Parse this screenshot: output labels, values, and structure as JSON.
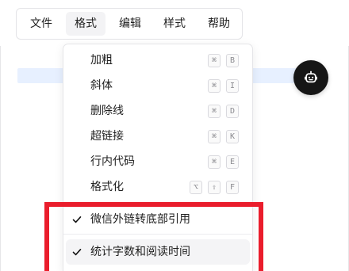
{
  "menubar": {
    "tabs": [
      "文件",
      "格式",
      "编辑",
      "样式",
      "帮助"
    ],
    "active_tab": "格式"
  },
  "format_menu": {
    "items": [
      {
        "label": "加粗",
        "shortcut": [
          "⌘",
          "B"
        ]
      },
      {
        "label": "斜体",
        "shortcut": [
          "⌘",
          "I"
        ]
      },
      {
        "label": "删除线",
        "shortcut": [
          "⌘",
          "D"
        ]
      },
      {
        "label": "超链接",
        "shortcut": [
          "⌘",
          "K"
        ]
      },
      {
        "label": "行内代码",
        "shortcut": [
          "⌘",
          "E"
        ]
      },
      {
        "label": "格式化",
        "shortcut": [
          "⌥",
          "⇧",
          "F"
        ]
      }
    ],
    "options": [
      {
        "label": "微信外链转底部引用",
        "checked": true
      },
      {
        "label": "统计字数和阅读时间",
        "checked": true
      }
    ]
  },
  "floating_assistant": {
    "icon": "robot-icon"
  },
  "colors": {
    "accent_border": "#ea1d2c",
    "assistant_bg": "#161616",
    "highlight": "#e7f0ff"
  }
}
